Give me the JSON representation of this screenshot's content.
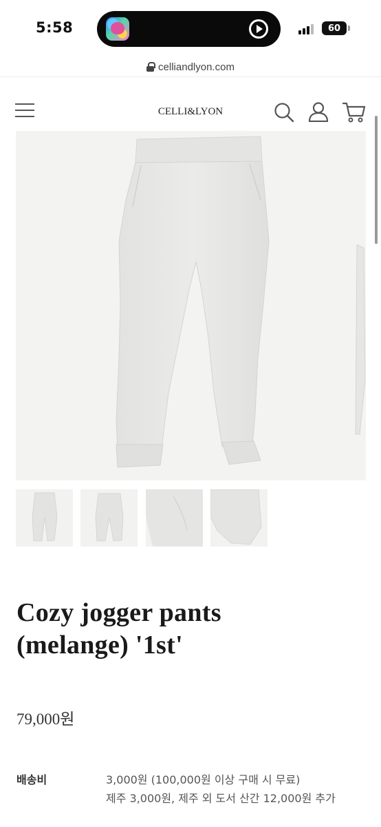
{
  "status_bar": {
    "time": "5:58",
    "battery": "60",
    "app_icon": "heart-app-icon",
    "island_icon": "play-circle-icon"
  },
  "browser": {
    "url": "celliandlyon.com",
    "lock_icon": "lock-icon"
  },
  "header": {
    "logo": "CELLI&LYON",
    "icons": [
      "menu-icon",
      "search-icon",
      "user-icon",
      "cart-icon"
    ]
  },
  "product": {
    "title_line1": "Cozy jogger pants",
    "title_line2": "(melange) '1st'",
    "price": "79,000원",
    "thumbnails": [
      "front-view",
      "back-view",
      "detail-waist",
      "detail-cuff"
    ]
  },
  "shipping": {
    "label": "배송비",
    "line1": "3,000원 (100,000원 이상 구매 시 무료)",
    "line2": "제주 3,000원, 제주 외 도서 산간 12,000원 추가"
  },
  "colors": {
    "image_bg": "#f3f3f1",
    "garment": "#e6e6e4",
    "text": "#1a1a1a"
  }
}
